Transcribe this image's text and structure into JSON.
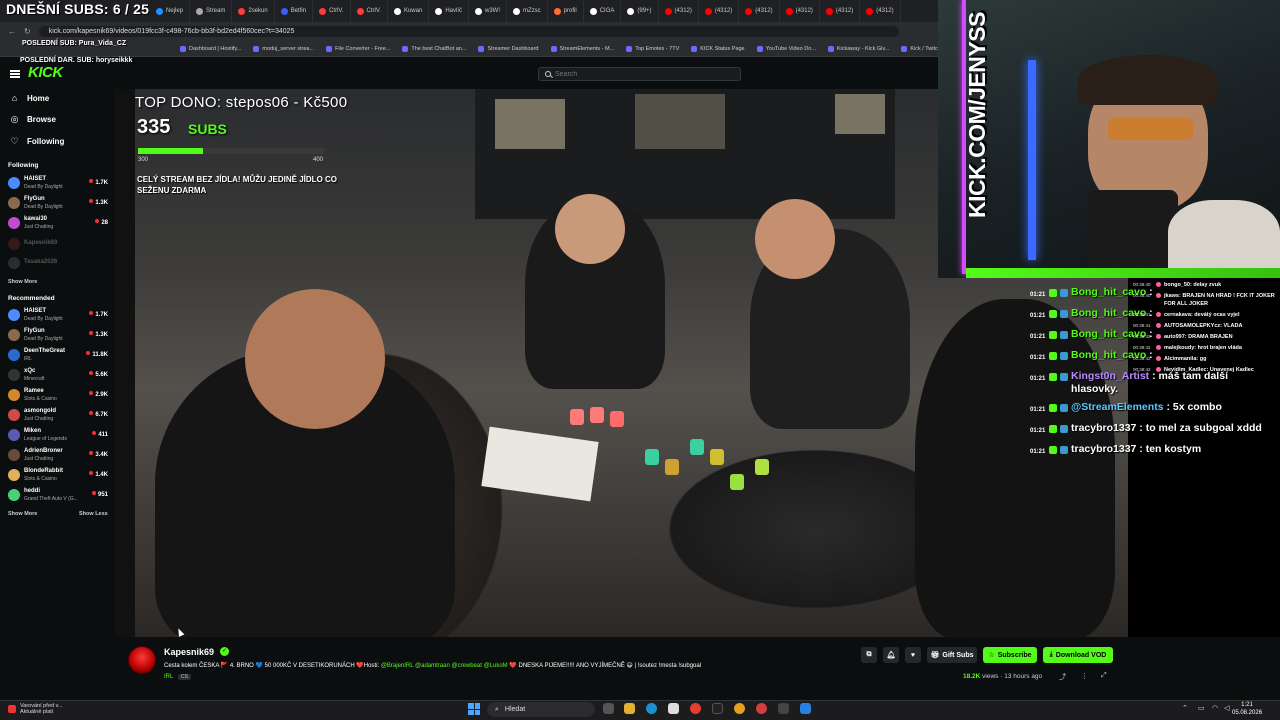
{
  "overlay": {
    "daily_subs": "DNEŠNÍ SUBS: 6 / 25",
    "last_sub": "POSLEDNÍ SUB: Pura_Vida_CZ",
    "last_donation": "POSLEDNÍ DAR. SUB: horyseikkk",
    "top_dono": "TOP DONO: stepos06 - Kč500",
    "sub_count": "335",
    "subs_label": "SUBS",
    "goal_min": "300",
    "goal_max": "400",
    "goal_progress": 0.35,
    "note": "CELÝ STREAM BEZ JÍDLA! MŮŽU JEDINĚ JÍDLO CO SEŽENU ZDARMA",
    "webcam_text": "KICK.COM/JENYSS"
  },
  "browser": {
    "tabs": [
      {
        "label": "Nejlep",
        "color": "#1e90ff"
      },
      {
        "label": "Stream",
        "color": "#aaaaaa"
      },
      {
        "label": "2sekun",
        "color": "#ff3b3b"
      },
      {
        "label": "Betfin",
        "color": "#3b5bff"
      },
      {
        "label": "CtrlV.",
        "color": "#ff3b3b"
      },
      {
        "label": "CtrlV.",
        "color": "#ff3b3b"
      },
      {
        "label": "Kuwan",
        "color": "#ffffff"
      },
      {
        "label": "Havlíč",
        "color": "#ffffff"
      },
      {
        "label": "w3W!",
        "color": "#ffffff"
      },
      {
        "label": "mZzsc",
        "color": "#ffffff"
      },
      {
        "label": "profil",
        "color": "#ff6b3b"
      },
      {
        "label": "CIGA",
        "color": "#ffffff"
      },
      {
        "label": "(99+)",
        "color": "#ffffff"
      },
      {
        "label": "(4312)",
        "color": "#ff0000"
      },
      {
        "label": "(4312)",
        "color": "#ff0000"
      },
      {
        "label": "(4312)",
        "color": "#ff0000"
      },
      {
        "label": "(4312)",
        "color": "#ff0000"
      },
      {
        "label": "(4312)",
        "color": "#ff0000"
      },
      {
        "label": "(4312)",
        "color": "#ff0000"
      }
    ],
    "url": "kick.com/kapesnik69/videos/019fcc3f-c498-76cb-bb3f-bd2ed4f560cec?t=34025",
    "bookmarks": [
      "Dashboard | Hostify...",
      "moduj_server strea...",
      "File Converter - Free...",
      "The best ChatBot an...",
      "Streamer Dashboard",
      "StreamElements - M...",
      "Top Emotes - 7TV",
      "KICK Status Page",
      "YouTube Video Do...",
      "Kickaway - Kick Giv...",
      "Kick / Twitch VOD d..."
    ]
  },
  "header": {
    "logo": "KICK",
    "search_placeholder": "Search"
  },
  "sidebar": {
    "nav": [
      "Home",
      "Browse",
      "Following"
    ],
    "following_title": "Following",
    "following": [
      {
        "name": "HAISET",
        "category": "Dead By Daylight",
        "viewers": "1.7K",
        "color": "#4a8cff"
      },
      {
        "name": "FlyGun",
        "category": "Dead By Daylight",
        "viewers": "1.3K",
        "color": "#8a6a4a"
      },
      {
        "name": "kawai30",
        "category": "Just Chatting",
        "viewers": "28",
        "color": "#c04ad0"
      }
    ],
    "following_offline": [
      {
        "name": "Kapesnik69",
        "color": "#7a2a2a"
      },
      {
        "name": "Tasaka2026",
        "color": "#5a5a5a"
      }
    ],
    "show_more": "Show More",
    "recommended_title": "Recommended",
    "recommended": [
      {
        "name": "HAISET",
        "category": "Dead By Daylight",
        "viewers": "1.7K",
        "color": "#4a8cff"
      },
      {
        "name": "FlyGun",
        "category": "Dead By Daylight",
        "viewers": "1.3K",
        "color": "#8a6a4a"
      },
      {
        "name": "DeenTheGreat",
        "category": "IRL",
        "viewers": "11.8K",
        "color": "#2a6ad0"
      },
      {
        "name": "xQc",
        "category": "Minecraft",
        "viewers": "5.6K",
        "color": "#333333"
      },
      {
        "name": "Ramee",
        "category": "Slots & Casino",
        "viewers": "2.9K",
        "color": "#d08a2a"
      },
      {
        "name": "asmongold",
        "category": "Just Chatting",
        "viewers": "6.7K",
        "color": "#d04a4a"
      },
      {
        "name": "Miken",
        "category": "League of Legends",
        "viewers": "411",
        "color": "#5a5ab0"
      },
      {
        "name": "AdrienBroner",
        "category": "Just Chatting",
        "viewers": "3.4K",
        "color": "#6a4a3a"
      },
      {
        "name": "BlondeRabbit",
        "category": "Slots & Casino",
        "viewers": "1.4K",
        "color": "#e0b05a"
      },
      {
        "name": "heddi",
        "category": "Grand Theft Auto V (G...",
        "viewers": "951",
        "color": "#4ad07a"
      }
    ],
    "show_less": "Show Less"
  },
  "chat": [
    {
      "time": "01:21",
      "user": "Bong_hit_cavo",
      "sep": " :",
      "text": "",
      "color": "#53fc18"
    },
    {
      "time": "01:21",
      "user": "Bong_hit_cavo",
      "sep": " :",
      "text": "",
      "color": "#53fc18"
    },
    {
      "time": "01:21",
      "user": "Bong_hit_cavo",
      "sep": " :",
      "text": "",
      "color": "#53fc18"
    },
    {
      "time": "01:21",
      "user": "Bong_hit_cavo",
      "sep": " :",
      "text": "",
      "color": "#53fc18"
    },
    {
      "time": "01:21",
      "user": "Kingst0n_Artist",
      "sep": " :",
      "text": "máš tam další hlasovky.",
      "color": "#b98cff"
    },
    {
      "time": "01:21",
      "user": "@StreamElements",
      "sep": " :",
      "text": "5x combo",
      "color": "#5ac8ff"
    },
    {
      "time": "01:21",
      "user": "tracybro1337",
      "sep": " :",
      "text": "to mel za subgoal xddd",
      "color": "#ffffff"
    },
    {
      "time": "01:21",
      "user": "tracybro1337",
      "sep": " :",
      "text": "ten kostym",
      "color": "#ffffff"
    }
  ],
  "chat_small": [
    {
      "time": "00:38:40",
      "text": "bongo_50: delay zvuk"
    },
    {
      "time": "00:38:40",
      "text": "jkaws: BRAJEN NA HRAD ! FCK IT JOKER FOR ALL JOKER"
    },
    {
      "time": "00:38:41",
      "text": "cernakava: devátý ocas vyjel"
    },
    {
      "time": "00:38:41",
      "text": "AUTOSAMOLEPKYcz: VLADA"
    },
    {
      "time": "00:38:42",
      "text": "auto997: DRAMA BRAJEN"
    },
    {
      "time": "00:38:42",
      "text": "malejkoudy: hrot brajen vláda"
    },
    {
      "time": "00:38:42",
      "text": "Alcimmanila: gg"
    },
    {
      "time": "00:38:42",
      "text": "Nevidim_Kadlec: Unavenej Kadlec"
    }
  ],
  "stream": {
    "streamer": "Kapesnik69",
    "title_a": "Cesta kolem ČESKA 🚩 4. BRNO 💙 50 000KČ V DESETIKORUNÁCH ❤️Hosti: ",
    "title_b": "@BrajenIRL @adamtraan @crewbeat @LukoM",
    "title_c": " ❤️ DNESKA PIJEME!!!!! ANO VYJÍMEČNĚ 😃 | !soutez !mesta !subgoal",
    "category": "IRL",
    "language": "CS",
    "views_count": "18.2K",
    "views_label": "views",
    "uploaded": "13 hours ago",
    "gift_label": "Gift Subs",
    "subscribe_label": "Subscribe",
    "download_label": "Download VOD"
  },
  "taskbar": {
    "weather_line1": "Varování před v...",
    "weather_line2": "Aktuálně platí",
    "search_placeholder": "Hledat",
    "time": "1:21",
    "date": "05.08.2026"
  }
}
